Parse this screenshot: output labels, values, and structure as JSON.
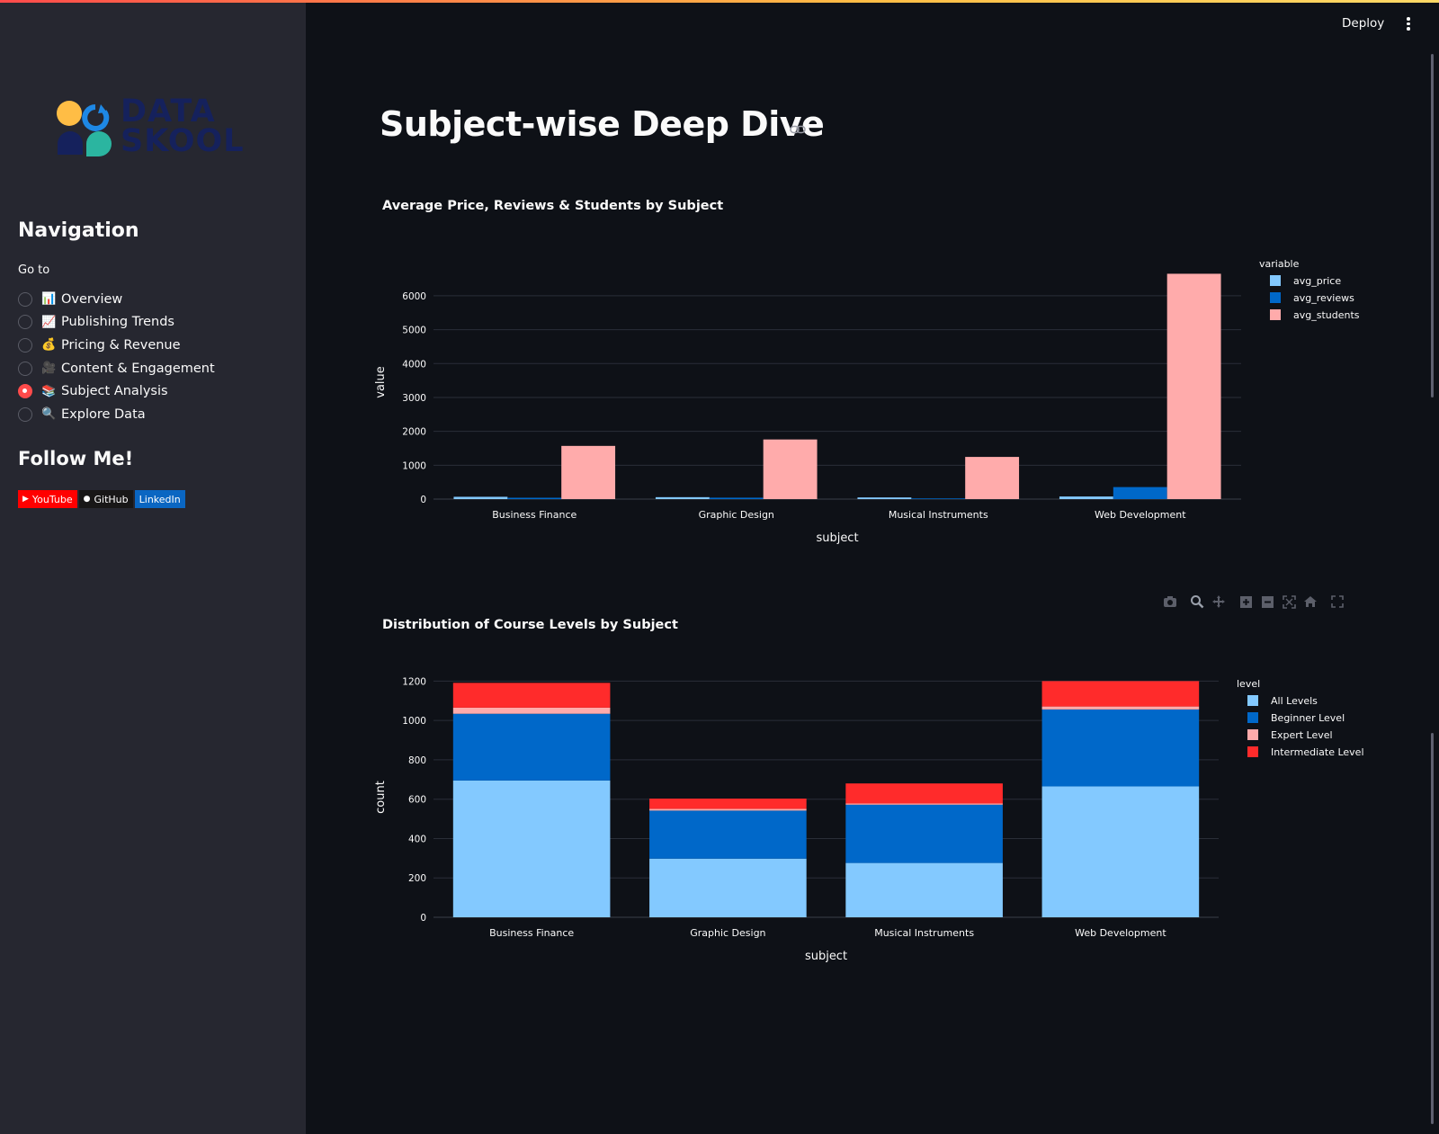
{
  "sidebar": {
    "logo_text_line1": "DATA",
    "logo_text_line2": "SKOOL",
    "nav_title": "Navigation",
    "goto_label": "Go to",
    "items": [
      {
        "emoji": "📊",
        "label": "Overview",
        "selected": false
      },
      {
        "emoji": "📈",
        "label": "Publishing Trends",
        "selected": false
      },
      {
        "emoji": "💰",
        "label": "Pricing & Revenue",
        "selected": false
      },
      {
        "emoji": "🎥",
        "label": "Content & Engagement",
        "selected": false
      },
      {
        "emoji": "📚",
        "label": "Subject Analysis",
        "selected": true
      },
      {
        "emoji": "🔍",
        "label": "Explore Data",
        "selected": false
      }
    ],
    "follow_title": "Follow Me!",
    "badges": [
      {
        "label": "YouTube",
        "icon": "youtube-icon",
        "color": "#ff0000"
      },
      {
        "label": "GitHub",
        "icon": "github-icon",
        "color": "#181717"
      },
      {
        "label": "LinkedIn",
        "icon": "linkedin-icon",
        "color": "#0a66c2"
      }
    ]
  },
  "header": {
    "deploy_label": "Deploy",
    "menu_icon": "kebab-menu-icon"
  },
  "main": {
    "page_title": "Subject-wise Deep Dive",
    "title_link_icon": "link-icon",
    "modebar_icons": [
      "camera-icon",
      "zoom-icon",
      "pan-icon",
      "zoom-in-icon",
      "zoom-out-icon",
      "autoscale-icon",
      "reset-axes-icon",
      "fullscreen-icon"
    ]
  },
  "chart_data": [
    {
      "type": "bar",
      "barmode": "group",
      "title": "Average Price, Reviews & Students by Subject",
      "xlabel": "subject",
      "ylabel": "value",
      "ylim": [
        0,
        6900
      ],
      "yticks": [
        0,
        1000,
        2000,
        3000,
        4000,
        5000,
        6000
      ],
      "legend_title": "variable",
      "legend_placement": "top-right",
      "grid": true,
      "categories": [
        "Business Finance",
        "Graphic Design",
        "Musical Instruments",
        "Web Development"
      ],
      "series": [
        {
          "name": "avg_price",
          "color": "#83c9ff",
          "values": [
            68,
            57,
            49,
            77
          ]
        },
        {
          "name": "avg_reviews",
          "color": "#0068c9",
          "values": [
            40,
            42,
            20,
            355
          ]
        },
        {
          "name": "avg_students",
          "color": "#ffabab",
          "values": [
            1570,
            1760,
            1245,
            6650
          ]
        }
      ]
    },
    {
      "type": "bar",
      "barmode": "stack",
      "title": "Distribution of Course Levels by Subject",
      "xlabel": "subject",
      "ylabel": "count",
      "ylim": [
        0,
        1220
      ],
      "yticks": [
        0,
        200,
        400,
        600,
        800,
        1000,
        1200
      ],
      "legend_title": "level",
      "legend_placement": "top-right",
      "grid": true,
      "categories": [
        "Business Finance",
        "Graphic Design",
        "Musical Instruments",
        "Web Development"
      ],
      "series": [
        {
          "name": "All Levels",
          "color": "#83c9ff",
          "values": [
            695,
            298,
            276,
            665
          ]
        },
        {
          "name": "Beginner Level",
          "color": "#0068c9",
          "values": [
            339,
            244,
            296,
            391
          ]
        },
        {
          "name": "Expert Level",
          "color": "#ffabab",
          "values": [
            31,
            9,
            6,
            15
          ]
        },
        {
          "name": "Intermediate Level",
          "color": "#ff2b2b",
          "values": [
            126,
            52,
            102,
            129
          ]
        }
      ]
    }
  ]
}
